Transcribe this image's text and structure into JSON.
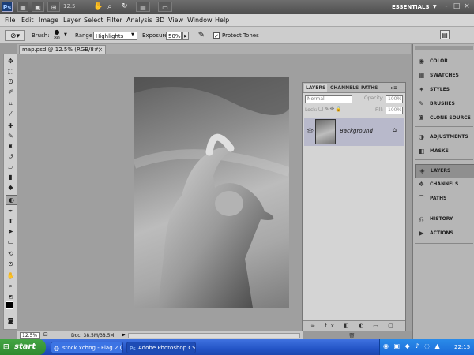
{
  "app": {
    "logo": "Ps",
    "zoom_value": "12.5",
    "workspace": "ESSENTIALS",
    "window_controls": [
      "-",
      "□",
      "×"
    ]
  },
  "menu": [
    "File",
    "Edit",
    "Image",
    "Layer",
    "Select",
    "Filter",
    "Analysis",
    "3D",
    "View",
    "Window",
    "Help"
  ],
  "options": {
    "brush_label": "Brush:",
    "brush_size": "80",
    "range_label": "Range:",
    "range_value": "Highlights",
    "exposure_label": "Exposure:",
    "exposure_value": "50%",
    "protect_tones_label": "Protect Tones"
  },
  "document": {
    "tab_title": "map.psd @ 12.5% (RGB/8#)",
    "tab_close": "×"
  },
  "status": {
    "zoom": "12.5%",
    "doc_info": "Doc: 38.5M/38.5M"
  },
  "layers_panel": {
    "tabs": [
      "LAYERS",
      "CHANNELS",
      "PATHS"
    ],
    "blend_mode": "Normal",
    "opacity_label": "Opacity:",
    "opacity_value": "100%",
    "lock_label": "Lock:",
    "fill_label": "Fill:",
    "fill_value": "100%",
    "layer_name": "Background"
  },
  "dock": {
    "groups": [
      [
        "COLOR",
        "SWATCHES",
        "STYLES",
        "BRUSHES",
        "CLONE SOURCE"
      ],
      [
        "ADJUSTMENTS",
        "MASKS"
      ],
      [
        "LAYERS",
        "CHANNELS",
        "PATHS"
      ],
      [
        "HISTORY",
        "ACTIONS"
      ]
    ],
    "icons": [
      [
        "palette-icon",
        "swatches-icon",
        "styles-icon",
        "brushes-icon",
        "clone-source-icon"
      ],
      [
        "adjustments-icon",
        "masks-icon"
      ],
      [
        "layers-icon",
        "channels-icon",
        "paths-icon"
      ],
      [
        "history-icon",
        "actions-icon"
      ]
    ],
    "active": "LAYERS"
  },
  "taskbar": {
    "start": "start",
    "tasks": [
      "stock.xchng - Flag 2 (...",
      "Adobe Photoshop CS..."
    ],
    "clock": "22:15"
  },
  "colors": {
    "active_layer": "#b8b9cb",
    "taskbar": "#2455c7",
    "start": "#2f8a2f"
  }
}
